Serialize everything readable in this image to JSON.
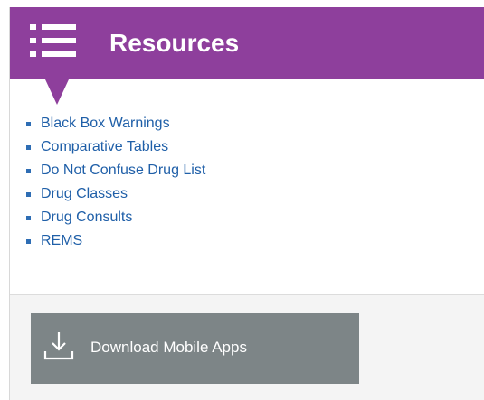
{
  "header": {
    "title": "Resources",
    "icon": "list-icon",
    "color": "#8e3f9c"
  },
  "resources": {
    "items": [
      {
        "label": "Black Box Warnings"
      },
      {
        "label": "Comparative Tables"
      },
      {
        "label": "Do Not Confuse Drug List"
      },
      {
        "label": "Drug Classes"
      },
      {
        "label": "Drug Consults"
      },
      {
        "label": "REMS"
      }
    ],
    "link_color": "#1f5fa8"
  },
  "download": {
    "label": "Download Mobile Apps",
    "icon": "download-icon",
    "color": "#7d8587"
  }
}
